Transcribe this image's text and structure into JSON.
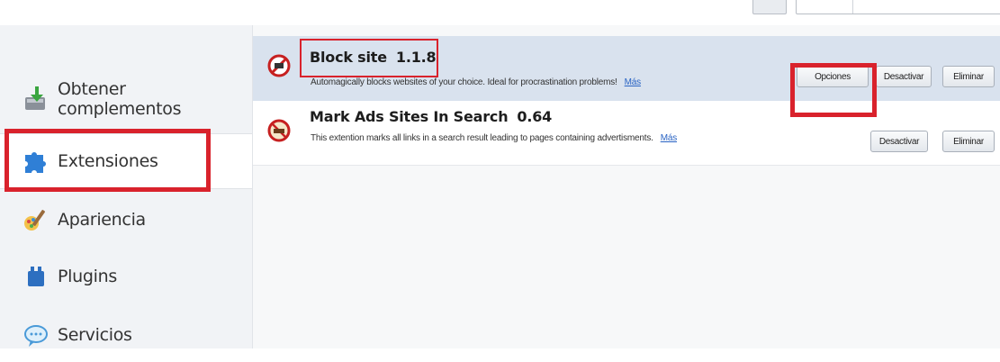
{
  "sidebar": {
    "items": [
      {
        "label": "Obtener complementos",
        "icon": "get-addons-download-icon",
        "selected": false
      },
      {
        "label": "Extensiones",
        "icon": "puzzle-piece-icon",
        "selected": true
      },
      {
        "label": "Apariencia",
        "icon": "paintbrush-icon",
        "selected": false
      },
      {
        "label": "Plugins",
        "icon": "plugin-block-icon",
        "selected": false
      },
      {
        "label": "Servicios",
        "icon": "chat-bubble-icon",
        "selected": false
      }
    ]
  },
  "addons": [
    {
      "name": "Block site",
      "version": "1.1.8",
      "description": "Automagically blocks websites of your choice. Ideal for procrastination problems!",
      "more_link": "Más",
      "icon": "block-site-icon",
      "buttons": {
        "options": "Opciones",
        "disable": "Desactivar",
        "remove": "Eliminar"
      },
      "selected": true
    },
    {
      "name": "Mark Ads Sites In Search",
      "version": "0.64",
      "description": "This extention marks all links in a search result leading to pages containing advertisments.",
      "more_link": "Más",
      "icon": "no-ads-icon",
      "buttons": {
        "disable": "Desactivar",
        "remove": "Eliminar"
      },
      "selected": false
    }
  ],
  "colors": {
    "highlight_red": "#d9222c",
    "selected_row": "#d9e2ee",
    "link_blue": "#2a64c4"
  }
}
